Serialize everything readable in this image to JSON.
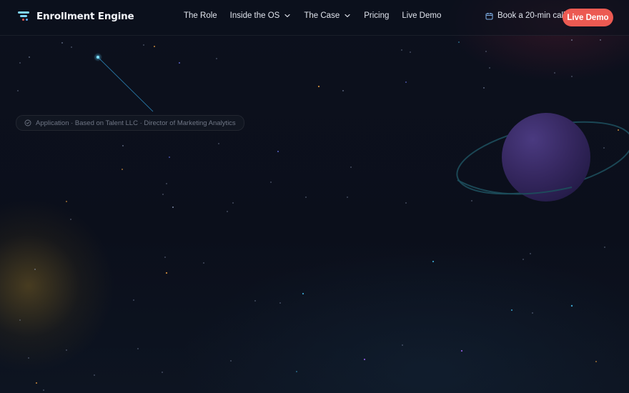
{
  "brand": {
    "name": "Enrollment Engine",
    "colors": {
      "bar_top": "#7fd3f3",
      "bar_mid": "#7fd3f3",
      "dot_red": "#ec5a52",
      "dot_blue": "#5aa7f0"
    }
  },
  "nav": {
    "items": [
      {
        "label": "The Role",
        "has_dropdown": false
      },
      {
        "label": "Inside the OS",
        "has_dropdown": true
      },
      {
        "label": "The Case",
        "has_dropdown": true
      },
      {
        "label": "Pricing",
        "has_dropdown": false
      },
      {
        "label": "Live Demo",
        "has_dropdown": false
      }
    ]
  },
  "header_actions": {
    "book_call_label": "Book a 20-min call",
    "book_call_icon": "calendar-icon",
    "cta_label": "Live Demo"
  },
  "hero": {
    "badge_text": "Application · Based on Talent LLC · Director of Marketing Analytics",
    "badge_icon": "check-circle-icon"
  },
  "colors": {
    "background": "#0b0f1c",
    "accent": "#ec5a52",
    "planet": "#3a2a6a",
    "ring": "#1f4a5a"
  }
}
